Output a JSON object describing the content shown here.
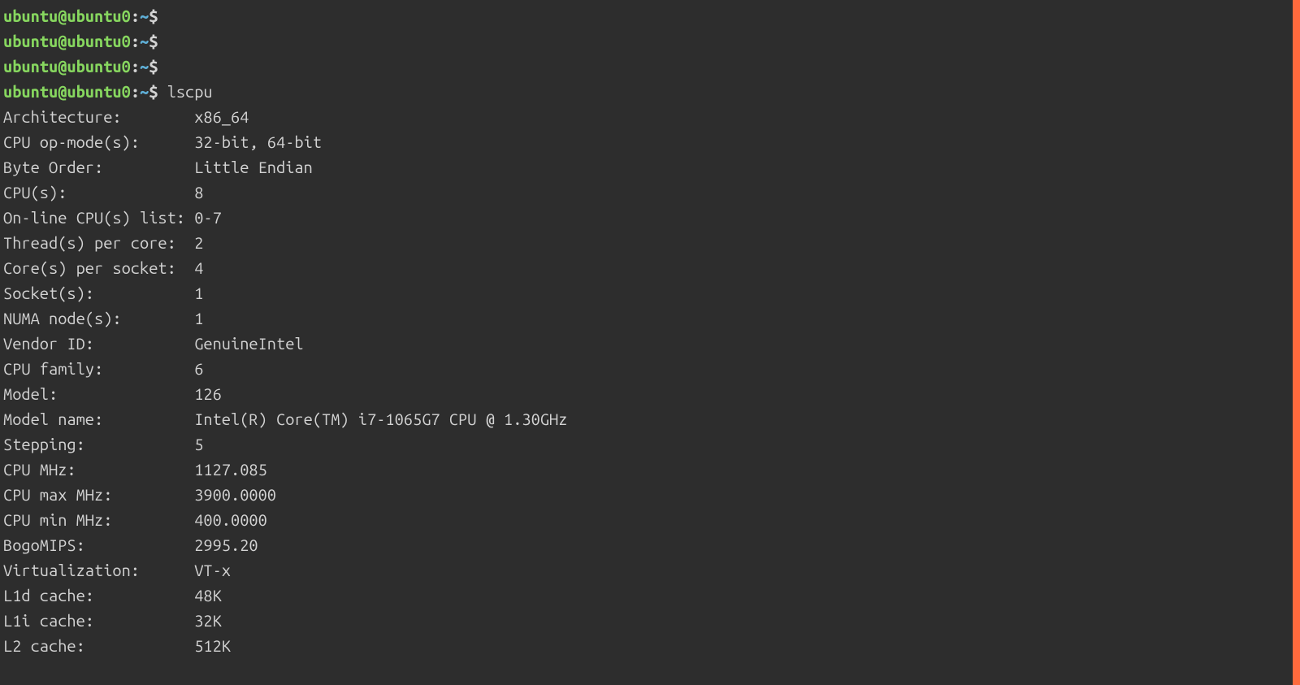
{
  "prompt": {
    "user_host": "ubuntu@ubuntu0",
    "colon": ":",
    "path": "~",
    "dollar": "$"
  },
  "command": "lscpu",
  "output": [
    {
      "label": "Architecture:",
      "value": "x86_64"
    },
    {
      "label": "CPU op-mode(s):",
      "value": "32-bit, 64-bit"
    },
    {
      "label": "Byte Order:",
      "value": "Little Endian"
    },
    {
      "label": "CPU(s):",
      "value": "8"
    },
    {
      "label": "On-line CPU(s) list:",
      "value": "0-7"
    },
    {
      "label": "Thread(s) per core:",
      "value": "2"
    },
    {
      "label": "Core(s) per socket:",
      "value": "4"
    },
    {
      "label": "Socket(s):",
      "value": "1"
    },
    {
      "label": "NUMA node(s):",
      "value": "1"
    },
    {
      "label": "Vendor ID:",
      "value": "GenuineIntel"
    },
    {
      "label": "CPU family:",
      "value": "6"
    },
    {
      "label": "Model:",
      "value": "126"
    },
    {
      "label": "Model name:",
      "value": "Intel(R) Core(TM) i7-1065G7 CPU @ 1.30GHz"
    },
    {
      "label": "Stepping:",
      "value": "5"
    },
    {
      "label": "CPU MHz:",
      "value": "1127.085"
    },
    {
      "label": "CPU max MHz:",
      "value": "3900.0000"
    },
    {
      "label": "CPU min MHz:",
      "value": "400.0000"
    },
    {
      "label": "BogoMIPS:",
      "value": "2995.20"
    },
    {
      "label": "Virtualization:",
      "value": "VT-x"
    },
    {
      "label": "L1d cache:",
      "value": "48K"
    },
    {
      "label": "L1i cache:",
      "value": "32K"
    },
    {
      "label": "L2 cache:",
      "value": "512K"
    }
  ]
}
